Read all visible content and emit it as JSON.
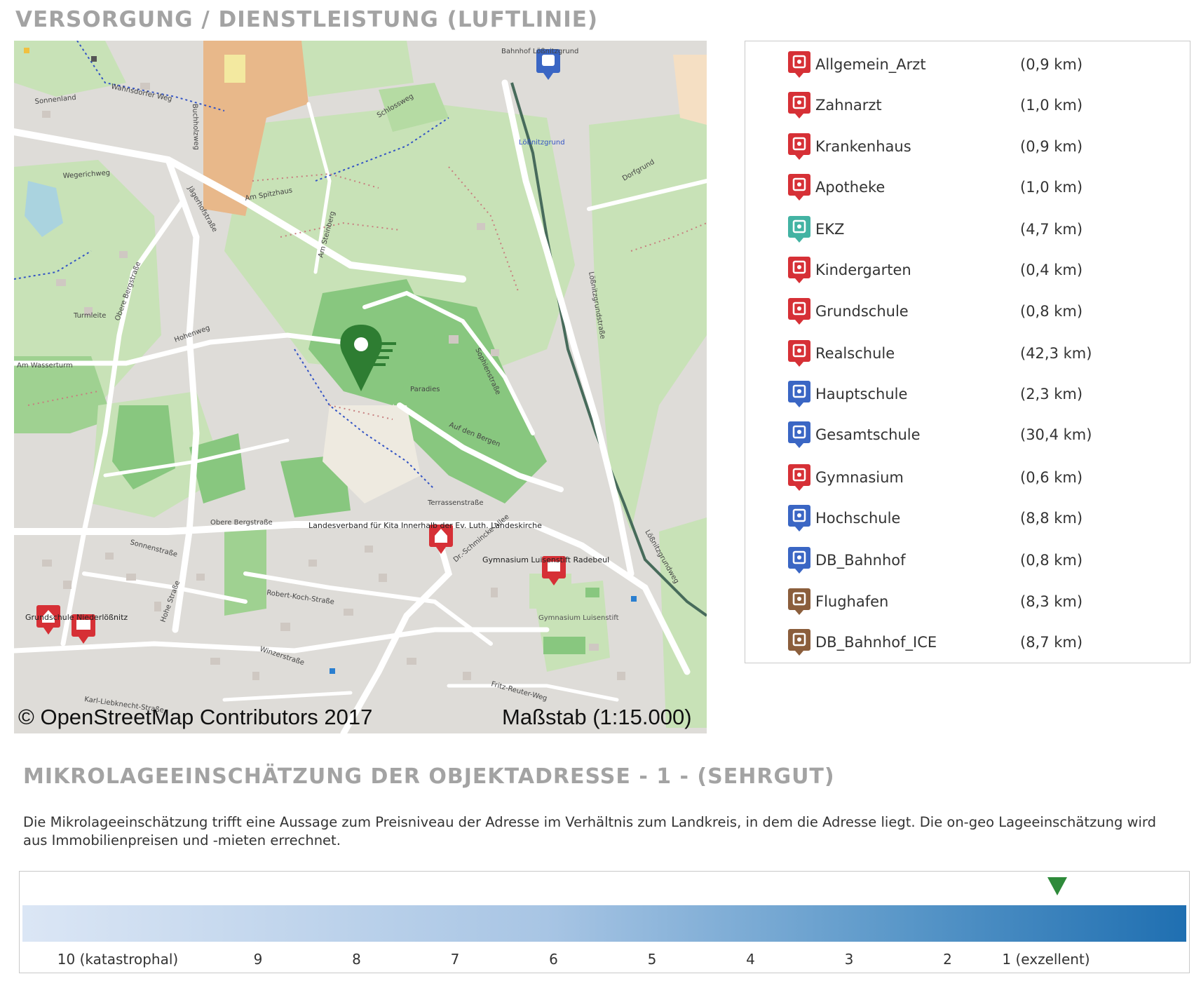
{
  "supply_section": {
    "title": "VERSORGUNG / DIENSTLEISTUNG (LUFTLINIE)"
  },
  "map": {
    "copyright": "© OpenStreetMap Contributors 2017",
    "scale_label": "Maßstab (1:15.000)",
    "street_labels": [
      "Bahnhof Lößnitzgrund",
      "Wahnsdorfer Weg",
      "Sonnenland",
      "Buchholzweg",
      "Schlossweg",
      "Lößnitzgrund",
      "Wegerichweg",
      "Am Spitzhaus",
      "Dorfgrund",
      "Jägerhofstraße",
      "Am Steinberg",
      "Turmleite",
      "Obere Bergstraße",
      "Hohenweg",
      "Am Wasserturm",
      "Sophienstraße",
      "Paradies",
      "Auf den Bergen",
      "Terrassenstraße",
      "Obere Bergstraße",
      "Sonnenstraße",
      "Robert-Koch-Straße",
      "Winzerstraße",
      "Hohe Straße",
      "Karl-Liebknecht-Straße",
      "Dr.-Schmincke-Allee",
      "Lößnitzgrundstraße",
      "Fritz-Reuter-Weg",
      "Lößnitzgrundweg"
    ],
    "poi_labels": [
      "Landesverband für Kita Innerhalb der Ev. Luth. Landeskirche",
      "Gymnasium Luisenstift Radebeul",
      "Grundschule Niederlößnitz",
      "Gymnasium Luisenstift"
    ]
  },
  "legend": {
    "items": [
      {
        "name": "Allgemein_Arzt",
        "distance": "(0,9 km)",
        "color": "#d63036",
        "icon": "doctor-icon"
      },
      {
        "name": "Zahnarzt",
        "distance": "(1,0 km)",
        "color": "#d63036",
        "icon": "tooth-icon"
      },
      {
        "name": "Krankenhaus",
        "distance": "(0,9 km)",
        "color": "#d63036",
        "icon": "ambulance-icon"
      },
      {
        "name": "Apotheke",
        "distance": "(1,0 km)",
        "color": "#d63036",
        "icon": "pharmacy-icon"
      },
      {
        "name": "EKZ",
        "distance": "(4,7 km)",
        "color": "#43b3a3",
        "icon": "shopping-icon"
      },
      {
        "name": "Kindergarten",
        "distance": "(0,4 km)",
        "color": "#d63036",
        "icon": "kindergarten-icon"
      },
      {
        "name": "Grundschule",
        "distance": "(0,8 km)",
        "color": "#d63036",
        "icon": "school-board-icon"
      },
      {
        "name": "Realschule",
        "distance": "(42,3 km)",
        "color": "#d63036",
        "icon": "school-bus-icon"
      },
      {
        "name": "Hauptschule",
        "distance": "(2,3 km)",
        "color": "#3a66c4",
        "icon": "school-bus-icon"
      },
      {
        "name": "Gesamtschule",
        "distance": "(30,4 km)",
        "color": "#3a66c4",
        "icon": "school-bus-icon"
      },
      {
        "name": "Gymnasium",
        "distance": "(0,6 km)",
        "color": "#d63036",
        "icon": "gymnasium-icon"
      },
      {
        "name": "Hochschule",
        "distance": "(8,8 km)",
        "color": "#3a66c4",
        "icon": "graduation-cap-icon"
      },
      {
        "name": "DB_Bahnhof",
        "distance": "(0,8 km)",
        "color": "#3a66c4",
        "icon": "train-icon"
      },
      {
        "name": "Flughafen",
        "distance": "(8,3 km)",
        "color": "#8b5e3c",
        "icon": "airplane-icon"
      },
      {
        "name": "DB_Bahnhof_ICE",
        "distance": "(8,7 km)",
        "color": "#8b5e3c",
        "icon": "train-icon"
      }
    ]
  },
  "micro": {
    "title": "MIKROLAGEEINSCHÄTZUNG DER OBJEKTADRESSE - 1 - (SEHRGUT)",
    "description": "Die Mikrolageeinschätzung trifft eine Aussage zum Preisniveau der Adresse im Verhältnis zum Landkreis, in dem die Adresse liegt. Die on-geo Lageeinschätzung wird aus Immobilienpreisen und -mieten errechnet.",
    "rating": 1,
    "ticks": [
      "10 (katastrophal)",
      "9",
      "8",
      "7",
      "6",
      "5",
      "4",
      "3",
      "2",
      "1 (exzellent)"
    ],
    "marker_color": "#2e8a3a"
  }
}
